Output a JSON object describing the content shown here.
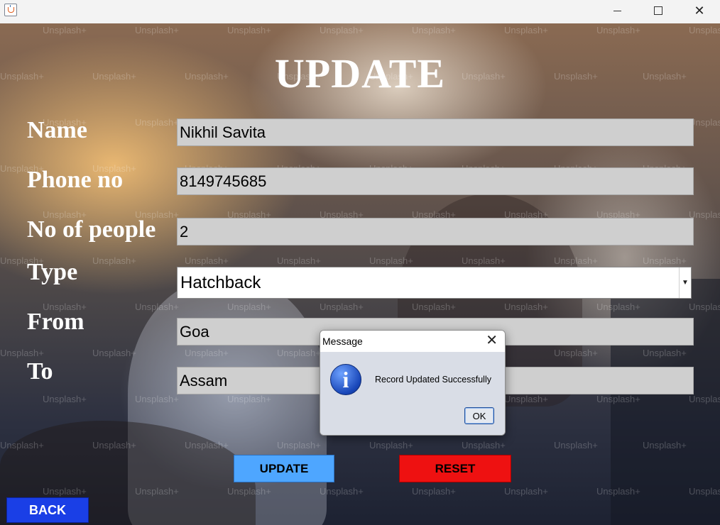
{
  "window": {
    "minimize_glyph": "",
    "maximize_glyph": "",
    "close_glyph": "✕"
  },
  "form": {
    "title": "UPDATE",
    "fields": {
      "name": {
        "label": "Name",
        "value": "Nikhil Savita"
      },
      "phone": {
        "label": "Phone no",
        "value": "8149745685"
      },
      "people": {
        "label": "No of people",
        "value": "2"
      },
      "type": {
        "label": "Type",
        "value": "Hatchback"
      },
      "from": {
        "label": "From",
        "value": "Goa"
      },
      "to": {
        "label": "To",
        "value": "Assam"
      }
    },
    "buttons": {
      "update": "UPDATE",
      "reset": "RESET",
      "back": "BACK"
    },
    "colors": {
      "update_button": "#4ea6ff",
      "reset_button": "#ee1111",
      "back_button": "#1a3fe6"
    }
  },
  "dialog": {
    "title": "Message",
    "message": "Record Updated Successfully",
    "ok_label": "OK",
    "icon": "info-icon"
  },
  "watermark": {
    "text": "Unsplash+"
  },
  "icons": {
    "app": "java-cup-icon",
    "dropdown": "chevron-down-icon"
  }
}
